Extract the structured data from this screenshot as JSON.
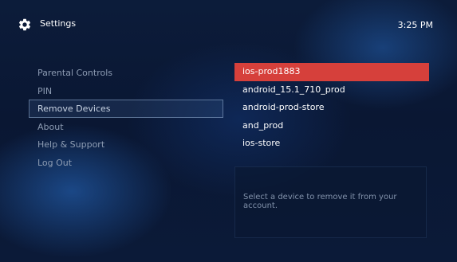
{
  "header": {
    "title": "Settings",
    "time": "3:25 PM",
    "icon": "gear-icon"
  },
  "menu": {
    "items": [
      {
        "label": "Parental Controls"
      },
      {
        "label": "PIN"
      },
      {
        "label": "Remove Devices"
      },
      {
        "label": "About"
      },
      {
        "label": "Help & Support"
      },
      {
        "label": "Log Out"
      }
    ],
    "selected": "Remove Devices"
  },
  "devices": {
    "items": [
      {
        "name": "ios-prod1883"
      },
      {
        "name": "android_15.1_710_prod"
      },
      {
        "name": "android-prod-store"
      },
      {
        "name": "and_prod"
      },
      {
        "name": "ios-store"
      }
    ],
    "highlighted": "ios-prod1883"
  },
  "info": {
    "text": "Select a device to remove it from your account."
  },
  "colors": {
    "accent": "#d6403b",
    "background": "#0c1c3a"
  }
}
